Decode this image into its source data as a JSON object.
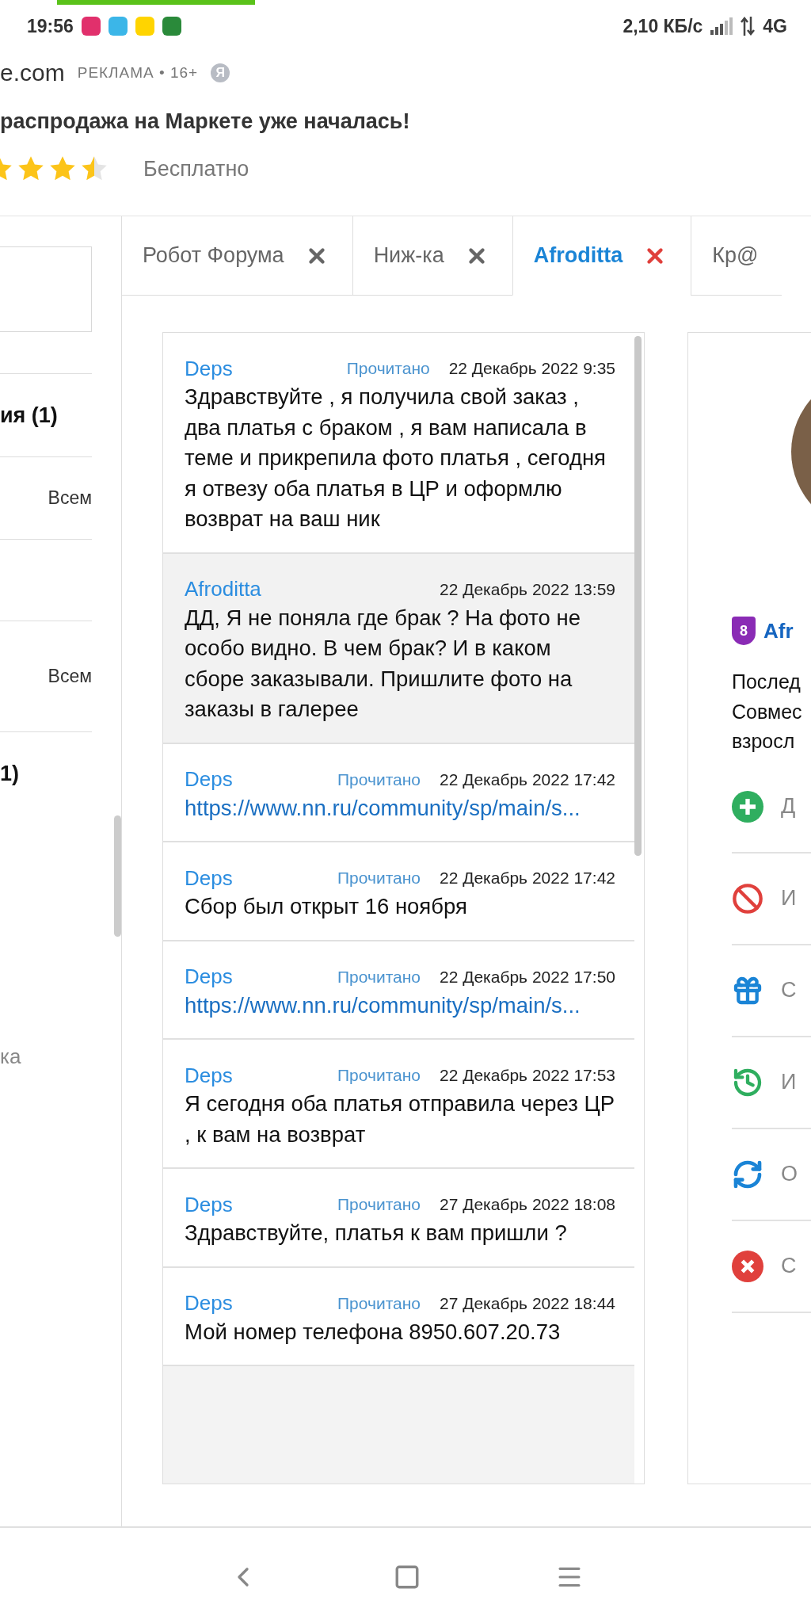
{
  "status_bar": {
    "time": "19:56",
    "speed": "2,10 КБ/с",
    "network": "4G"
  },
  "ad": {
    "domain": "e.com",
    "label": "РЕКЛАМА • 16+",
    "logo": "Я",
    "headline": "распродажа на Маркете уже началась!",
    "stars": 3.5,
    "price": "Бесплатно"
  },
  "sidebar": {
    "rows": [
      {
        "kind": "heading",
        "text": "ия (1)"
      },
      {
        "kind": "row",
        "text": "Всем"
      },
      {
        "kind": "blank"
      },
      {
        "kind": "row",
        "text": "Всем"
      },
      {
        "kind": "heading",
        "text": "1)"
      }
    ],
    "footer": "ка"
  },
  "tabs": [
    {
      "label": "Робот Форума",
      "selected": false,
      "closable": true
    },
    {
      "label": "Ниж-ка",
      "selected": false,
      "closable": true
    },
    {
      "label": "Afroditta",
      "selected": true,
      "closable": true
    },
    {
      "label": "Кр@",
      "selected": false,
      "closable": false
    }
  ],
  "messages": [
    {
      "kind": "text",
      "author": "Deps",
      "status": "Прочитано",
      "date": "22 Декабрь 2022 9:35",
      "text": "Здравствуйте , я получила свой заказ , два платья с браком , я вам написала в теме и прикрепила фото платья , сегодня я отвезу оба платья в ЦР и оформлю возврат на ваш ник",
      "highlighted": false
    },
    {
      "kind": "text",
      "author": "Afroditta",
      "date": "22 Декабрь 2022 13:59",
      "text": "ДД, Я не поняла где брак ? На фото не особо видно. В чем брак? И в каком сборе заказывали. Пришлите фото на заказы в галерее",
      "highlighted": true
    },
    {
      "kind": "link",
      "author": "Deps",
      "status": "Прочитано",
      "date": "22 Декабрь 2022 17:42",
      "text": "https://www.nn.ru/community/sp/main/s...",
      "highlighted": false
    },
    {
      "kind": "text",
      "author": "Deps",
      "status": "Прочитано",
      "date": "22 Декабрь 2022 17:42",
      "text": "Сбор был открыт 16 ноября",
      "highlighted": false
    },
    {
      "kind": "link",
      "author": "Deps",
      "status": "Прочитано",
      "date": "22 Декабрь 2022 17:50",
      "text": "https://www.nn.ru/community/sp/main/s...",
      "highlighted": false
    },
    {
      "kind": "text",
      "author": "Deps",
      "status": "Прочитано",
      "date": "22 Декабрь 2022 17:53",
      "text": "Я сегодня оба платья отправила через ЦР , к вам на возврат",
      "highlighted": false
    },
    {
      "kind": "text",
      "author": "Deps",
      "status": "Прочитано",
      "date": "27 Декабрь 2022 18:08",
      "text": "Здравствуйте, платья к вам пришли ?",
      "highlighted": false
    },
    {
      "kind": "text",
      "author": "Deps",
      "status": "Прочитано",
      "date": "27 Декабрь 2022 18:44",
      "text": "Мой номер телефона 8950.607.20.73",
      "highlighted": false
    }
  ],
  "profile": {
    "badge": "8",
    "name": "Afr",
    "lines": [
      "Послед",
      "Совмес",
      "взросл"
    ],
    "actions": [
      {
        "kind": "add",
        "label": "Д"
      },
      {
        "kind": "block",
        "label": "И"
      },
      {
        "kind": "gift",
        "label": "С"
      },
      {
        "kind": "history",
        "label": "И"
      },
      {
        "kind": "refresh",
        "label": "О"
      },
      {
        "kind": "remove",
        "label": "С"
      }
    ]
  }
}
